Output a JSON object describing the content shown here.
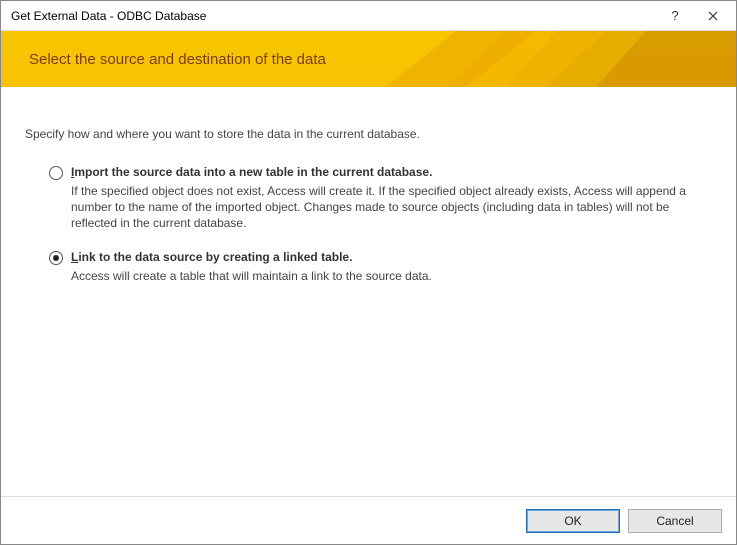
{
  "titlebar": {
    "title": "Get External Data - ODBC Database",
    "help": "?",
    "close": "✕"
  },
  "banner": {
    "title": "Select the source and destination of the data"
  },
  "intro": "Specify how and where you want to store the data in the current database.",
  "options": [
    {
      "checked": false,
      "accel": "I",
      "title_rest": "mport the source data into a new table in the current database.",
      "desc": "If the specified object does not exist, Access will create it. If the specified object already exists, Access will append a number to the name of the imported object. Changes made to source objects (including data in tables) will not be reflected in the current database."
    },
    {
      "checked": true,
      "accel": "L",
      "title_rest": "ink to the data source by creating a linked table.",
      "desc": "Access will create a table that will maintain a link to the source data."
    }
  ],
  "footer": {
    "ok": "OK",
    "cancel": "Cancel"
  }
}
